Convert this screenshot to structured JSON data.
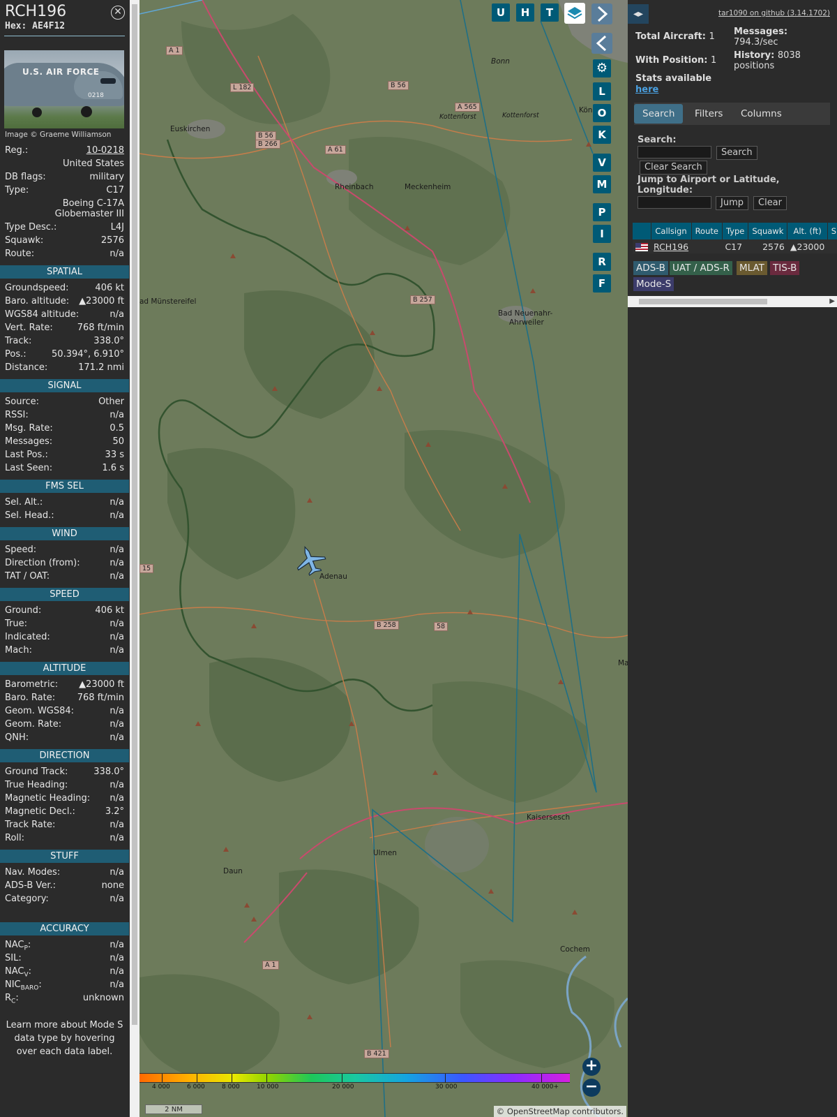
{
  "info": {
    "callsign": "RCH196",
    "hex_label": "Hex:",
    "hex_value": "AE4F12",
    "close_icon": "close-icon",
    "photo_text": "U.S. AIR FORCE",
    "photo_tail": "0218",
    "image_credit": "Image © Graeme Williamson",
    "general": [
      {
        "k": "Reg.:",
        "v": "10-0218",
        "link": true
      },
      {
        "k": "",
        "v": "United States"
      },
      {
        "k": "DB flags:",
        "v": "military"
      },
      {
        "k": "Type:",
        "v": "C17"
      },
      {
        "k": "",
        "v": "Boeing C-17A Globemaster III",
        "tall": true
      },
      {
        "k": "Type Desc.:",
        "v": "L4J"
      },
      {
        "k": "Squawk:",
        "v": "2576"
      },
      {
        "k": "Route:",
        "v": "n/a"
      }
    ],
    "sections": [
      {
        "title": "SPATIAL",
        "rows": [
          {
            "k": "Groundspeed:",
            "v": "406 kt"
          },
          {
            "k": "Baro. altitude:",
            "v": "▲23000 ft"
          },
          {
            "k": "WGS84 altitude:",
            "v": "n/a"
          },
          {
            "k": "Vert. Rate:",
            "v": "768 ft/min"
          },
          {
            "k": "Track:",
            "v": "338.0°"
          },
          {
            "k": "Pos.:",
            "v": "50.394°, 6.910°"
          },
          {
            "k": "Distance:",
            "v": "171.2 nmi"
          }
        ]
      },
      {
        "title": "SIGNAL",
        "rows": [
          {
            "k": "Source:",
            "v": "Other"
          },
          {
            "k": "RSSI:",
            "v": "n/a"
          },
          {
            "k": "Msg. Rate:",
            "v": "0.5"
          },
          {
            "k": "Messages:",
            "v": "50"
          },
          {
            "k": "Last Pos.:",
            "v": "33 s"
          },
          {
            "k": "Last Seen:",
            "v": "1.6 s"
          }
        ]
      },
      {
        "title": "FMS SEL",
        "rows": [
          {
            "k": "Sel. Alt.:",
            "v": "n/a"
          },
          {
            "k": "Sel. Head.:",
            "v": "n/a"
          }
        ]
      },
      {
        "title": "WIND",
        "rows": [
          {
            "k": "Speed:",
            "v": "n/a"
          },
          {
            "k": "Direction (from):",
            "v": "n/a"
          },
          {
            "k": "TAT / OAT:",
            "v": "n/a"
          }
        ]
      },
      {
        "title": "SPEED",
        "rows": [
          {
            "k": "Ground:",
            "v": "406 kt"
          },
          {
            "k": "True:",
            "v": "n/a"
          },
          {
            "k": "Indicated:",
            "v": "n/a"
          },
          {
            "k": "Mach:",
            "v": "n/a"
          }
        ]
      },
      {
        "title": "ALTITUDE",
        "rows": [
          {
            "k": "Barometric:",
            "v": "▲23000 ft"
          },
          {
            "k": "Baro. Rate:",
            "v": "768 ft/min"
          },
          {
            "k": "Geom. WGS84:",
            "v": "n/a"
          },
          {
            "k": "Geom. Rate:",
            "v": "n/a"
          },
          {
            "k": "QNH:",
            "v": "n/a"
          }
        ]
      },
      {
        "title": "DIRECTION",
        "rows": [
          {
            "k": "Ground Track:",
            "v": "338.0°"
          },
          {
            "k": "True Heading:",
            "v": "n/a"
          },
          {
            "k": "Magnetic Heading:",
            "v": "n/a"
          },
          {
            "k": "Magnetic Decl.:",
            "v": "3.2°"
          },
          {
            "k": "Track Rate:",
            "v": "n/a"
          },
          {
            "k": "Roll:",
            "v": "n/a"
          }
        ]
      },
      {
        "title": "STUFF",
        "rows": [
          {
            "k": "Nav. Modes:",
            "v": "n/a"
          },
          {
            "k": "ADS-B Ver.:",
            "v": "none"
          },
          {
            "k": "Category:",
            "v": "n/a"
          }
        ]
      },
      {
        "title": "ACCURACY",
        "gap": true,
        "rows": [
          {
            "k": "NACP:",
            "v": "n/a",
            "sub": "P",
            "base": "NAC"
          },
          {
            "k": "SIL:",
            "v": "n/a"
          },
          {
            "k": "NACV:",
            "v": "n/a",
            "sub": "V",
            "base": "NAC"
          },
          {
            "k": "NICBARO:",
            "v": "n/a",
            "sub": "BARO",
            "base": "NIC"
          },
          {
            "k": "RC:",
            "v": "unknown",
            "sub": "C",
            "base": "R"
          }
        ]
      }
    ],
    "learn_more": "Learn more about Mode S data type by hovering over each data label."
  },
  "map": {
    "buttons_top": [
      "U",
      "H",
      "T"
    ],
    "buttons_side": [
      "L",
      "O",
      "K",
      "V",
      "M",
      "P",
      "I",
      "R",
      "F"
    ],
    "layers_icon": "layers-icon",
    "settings_icon": "gear-icon",
    "next_icon": "chevron-right-icon",
    "prev_icon": "chevron-left-icon",
    "places": [
      {
        "name": "Euskirchen"
      },
      {
        "name": "Rheinbach"
      },
      {
        "name": "Meckenheim"
      },
      {
        "name": "Bonn"
      },
      {
        "name": "Kottenforst"
      },
      {
        "name": "Kottenforst"
      },
      {
        "name": "Königsw"
      },
      {
        "name": "ad Münstereifel"
      },
      {
        "name": "Bad Neuenahr-"
      },
      {
        "name": "Ahrweiler"
      },
      {
        "name": "Adenau"
      },
      {
        "name": "Kaisersesch"
      },
      {
        "name": "Ulmen"
      },
      {
        "name": "Daun"
      },
      {
        "name": "Cochem"
      },
      {
        "name": "Ma"
      }
    ],
    "roads": [
      "A 1",
      "L 182",
      "B 56",
      "A 565",
      "B 56",
      "B 266",
      "A 61",
      "B 257",
      "15",
      "B 258",
      "58",
      "A 1",
      "B 421"
    ],
    "colorbar_ticks": [
      "4 000",
      "6 000",
      "8 000",
      "10 000",
      "20 000",
      "30 000",
      "40 000+"
    ],
    "scale": "2 NM",
    "zoom_in": "+",
    "zoom_out": "−",
    "attribution": "© OpenStreetMap contributors."
  },
  "side": {
    "toggle_icon": "expand-collapse-icon",
    "github": "tar1090 on github (3.14.1702)",
    "total_label": "Total Aircraft:",
    "total_value": "1",
    "withpos_label": "With Position:",
    "withpos_value": "1",
    "messages_label": "Messages:",
    "messages_value": "794.3/sec",
    "history_label": "History:",
    "history_value": "8038 positions",
    "stats_label": "Stats available",
    "stats_link": "here",
    "tabs": [
      "Search",
      "Filters",
      "Columns"
    ],
    "search_label": "Search:",
    "search_btn": "Search",
    "clear_search_btn": "Clear Search",
    "jump_label": "Jump to Airport or Latitude, Longitude:",
    "jump_btn": "Jump",
    "clear_btn": "Clear",
    "table": {
      "headers": [
        "",
        "Callsign",
        "Route",
        "Type",
        "Squawk",
        "Alt. (ft)",
        "Spd"
      ],
      "row": {
        "callsign": "RCH196",
        "route": "",
        "type": "C17",
        "squawk": "2576",
        "alt": "▲23000",
        "spd": ""
      }
    },
    "sources": [
      {
        "label": "ADS-B",
        "color": "#2f5b6e"
      },
      {
        "label": "UAT / ADS-R",
        "color": "#34604a"
      },
      {
        "label": "MLAT",
        "color": "#6a5a30"
      },
      {
        "label": "TIS-B",
        "color": "#6a2a3e"
      },
      {
        "label": "Mode-S",
        "color": "#3c3c6a"
      }
    ]
  }
}
